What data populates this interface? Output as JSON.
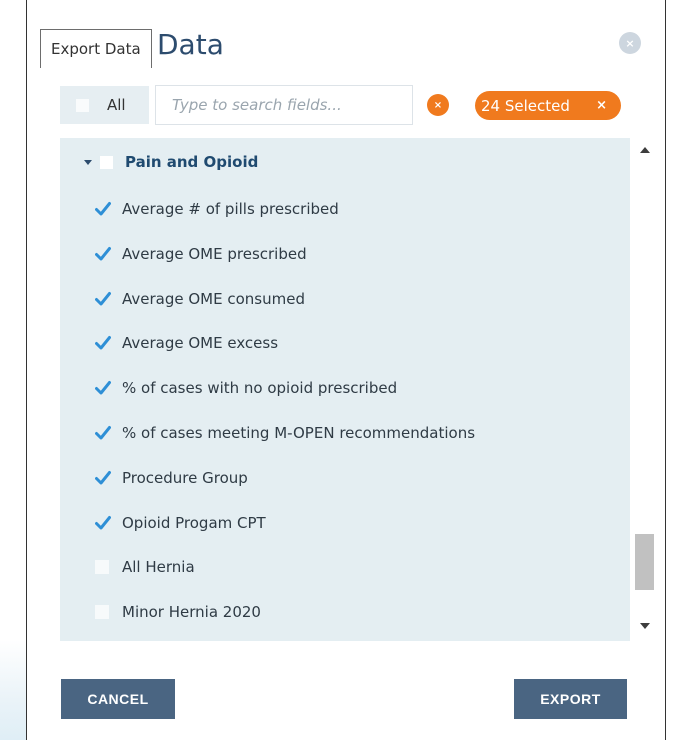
{
  "dialog": {
    "tab_label": "Export Data",
    "title": "Data",
    "close_symbol": "×"
  },
  "filter": {
    "all_label": "All",
    "search_placeholder": "Type to search fields...",
    "clear_symbol": "×",
    "selected_text": "24 Selected",
    "selected_clear_symbol": "×"
  },
  "group": {
    "label": "Pain and Opioid",
    "expanded": true,
    "checked": false
  },
  "items": [
    {
      "label": "Average # of pills prescribed",
      "checked": true
    },
    {
      "label": "Average OME prescribed",
      "checked": true
    },
    {
      "label": "Average OME consumed",
      "checked": true
    },
    {
      "label": "Average OME excess",
      "checked": true
    },
    {
      "label": "% of cases with no opioid prescribed",
      "checked": true
    },
    {
      "label": "% of cases meeting M-OPEN recommendations",
      "checked": true
    },
    {
      "label": "Procedure Group",
      "checked": true
    },
    {
      "label": "Opioid Progam CPT",
      "checked": true
    },
    {
      "label": "All Hernia",
      "checked": false
    },
    {
      "label": "Minor Hernia 2020",
      "checked": false
    }
  ],
  "footer": {
    "cancel_label": "CANCEL",
    "export_label": "EXPORT"
  },
  "colors": {
    "accent": "#f07a1e",
    "button": "#4a6582",
    "check": "#2e8fd6",
    "list_bg": "#e4eef2",
    "title": "#2d4c6e"
  }
}
